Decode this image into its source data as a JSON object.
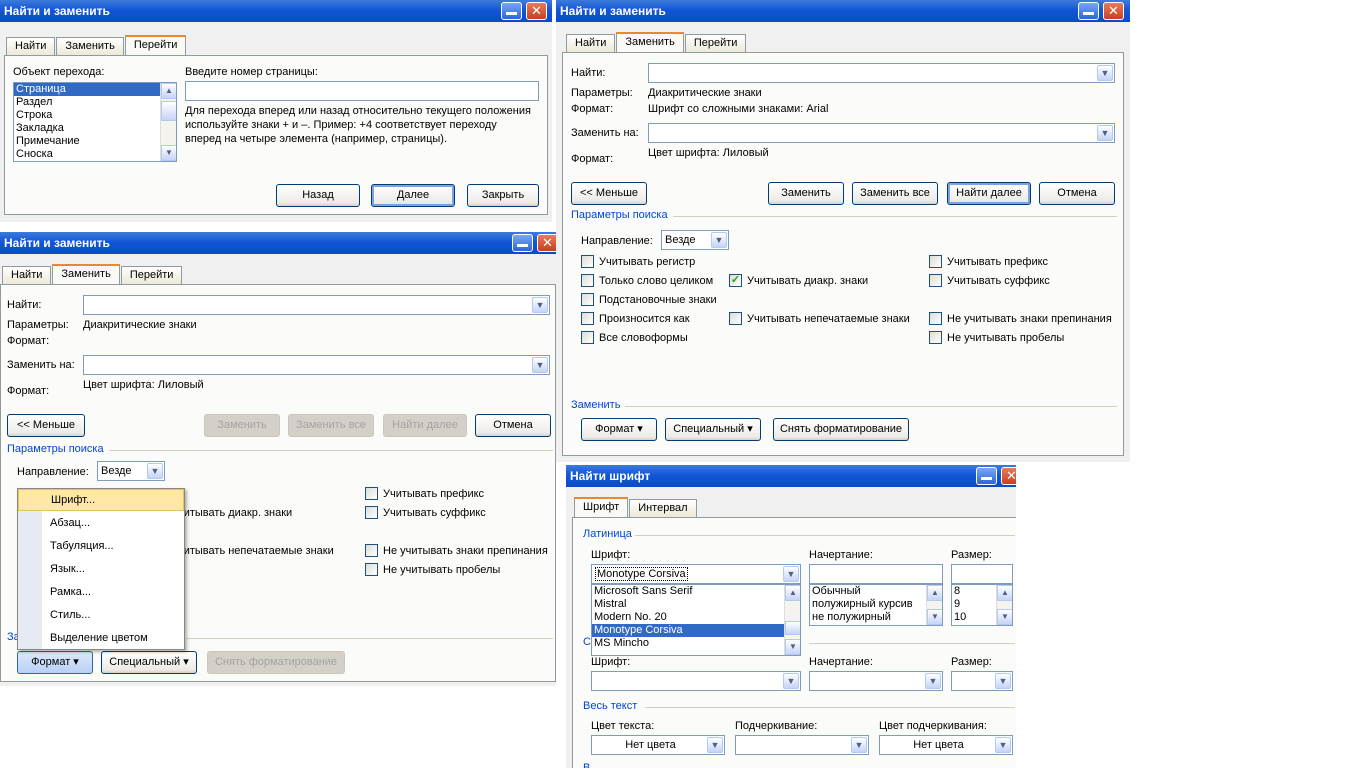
{
  "dialog_goto": {
    "title": "Найти и заменить",
    "tabs": [
      "Найти",
      "Заменить",
      "Перейти"
    ],
    "object_label": "Объект перехода:",
    "objects": [
      "Страница",
      "Раздел",
      "Строка",
      "Закладка",
      "Примечание",
      "Сноска"
    ],
    "page_label": "Введите номер страницы:",
    "page_value": "",
    "help_line1": "Для перехода вперед или назад относительно текущего положения",
    "help_line2": "используйте знаки + и –. Пример: +4 соответствует переходу",
    "help_line3": "вперед на четыре элемента (например, страницы).",
    "back": "Назад",
    "next": "Далее",
    "close": "Закрыть"
  },
  "dialog_replace_right": {
    "title": "Найти и заменить",
    "tabs": [
      "Найти",
      "Заменить",
      "Перейти"
    ],
    "find_label": "Найти:",
    "params_label": "Параметры:",
    "params_value": "Диакритические знаки",
    "format_label": "Формат:",
    "format_value": "Шрифт со сложными знаками: Arial",
    "replace_label": "Заменить на:",
    "format2_label": "Формат:",
    "format2_value": "Цвет шрифта: Лиловый",
    "less": "<< Меньше",
    "replace": "Заменить",
    "replace_all": "Заменить все",
    "find_next": "Найти далее",
    "cancel": "Отмена",
    "search_params": "Параметры поиска",
    "direction_label": "Направление:",
    "direction_value": "Везде",
    "options": {
      "match_case": "Учитывать регистр",
      "whole_word": "Только слово целиком",
      "wildcards": "Подстановочные знаки",
      "sounds_like": "Произносится как",
      "all_forms": "Все словоформы",
      "diacritics": "Учитывать диакр. знаки",
      "nonprint": "Учитывать непечатаемые знаки",
      "prefix": "Учитывать префикс",
      "suffix": "Учитывать суффикс",
      "ignore_punct": "Не учитывать знаки препинания",
      "ignore_spaces": "Не учитывать пробелы"
    },
    "replace_group": "Заменить",
    "format_btn": "Формат",
    "special_btn": "Специальный",
    "clear_format": "Снять форматирование"
  },
  "dialog_replace_left": {
    "title": "Найти и заменить",
    "tabs": [
      "Найти",
      "Заменить",
      "Перейти"
    ],
    "find_label": "Найти:",
    "params_label": "Параметры:",
    "params_value": "Диакритические знаки",
    "format_label": "Формат:",
    "replace_label": "Заменить на:",
    "format2_label": "Формат:",
    "format2_value": "Цвет шрифта: Лиловый",
    "less": "<< Меньше",
    "replace": "Заменить",
    "replace_all": "Заменить все",
    "find_next": "Найти далее",
    "cancel": "Отмена",
    "search_params": "Параметры поиска",
    "direction_label": "Направление:",
    "direction_value": "Везде",
    "diacritics_partial": "Учитывать диакр. знаки",
    "nonprint_partial": "Учитывать непечатаемые знаки",
    "prefix": "Учитывать префикс",
    "suffix": "Учитывать суффикс",
    "ignore_punct": "Не учитывать знаки препинания",
    "ignore_spaces": "Не учитывать пробелы",
    "replace_group_partial": "За",
    "format_btn": "Формат",
    "special_btn": "Специальный",
    "clear_format": "Снять форматирование",
    "menu": [
      "Шрифт...",
      "Абзац...",
      "Табуляция...",
      "Язык...",
      "Рамка...",
      "Стиль...",
      "Выделение цветом"
    ]
  },
  "dialog_font": {
    "title": "Найти шрифт",
    "tabs": [
      "Шрифт",
      "Интервал"
    ],
    "latin": "Латиница",
    "font_label": "Шрифт:",
    "font_value": "Monotype Corsiva",
    "fonts": [
      "Microsoft Sans Serif",
      "Mistral",
      "Modern No. 20",
      "Monotype Corsiva",
      "MS Mincho"
    ],
    "style_label": "Начертание:",
    "styles": [
      "Обычный",
      "полужирный курсив",
      "не полужирный"
    ],
    "size_label": "Размер:",
    "sizes": [
      "8",
      "9",
      "10"
    ],
    "complex_partial": "С",
    "font2_label": "Шрифт:",
    "style2_label": "Начертание:",
    "size2_label": "Размер:",
    "all_text": "Весь текст",
    "color_label": "Цвет текста:",
    "color_value": "Нет цвета",
    "underline_label": "Подчеркивание:",
    "ucolor_label": "Цвет подчеркивания:",
    "ucolor_value": "Нет цвета",
    "bottom_partial": "В"
  }
}
